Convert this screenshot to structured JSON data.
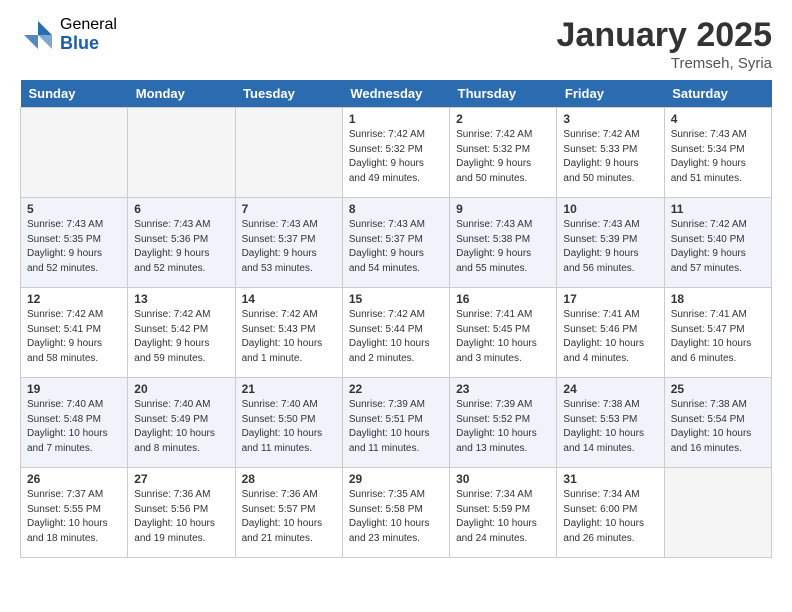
{
  "logo": {
    "general": "General",
    "blue": "Blue"
  },
  "header": {
    "month": "January 2025",
    "location": "Tremseh, Syria"
  },
  "weekdays": [
    "Sunday",
    "Monday",
    "Tuesday",
    "Wednesday",
    "Thursday",
    "Friday",
    "Saturday"
  ],
  "weeks": [
    [
      {
        "day": "",
        "info": ""
      },
      {
        "day": "",
        "info": ""
      },
      {
        "day": "",
        "info": ""
      },
      {
        "day": "1",
        "info": "Sunrise: 7:42 AM\nSunset: 5:32 PM\nDaylight: 9 hours\nand 49 minutes."
      },
      {
        "day": "2",
        "info": "Sunrise: 7:42 AM\nSunset: 5:32 PM\nDaylight: 9 hours\nand 50 minutes."
      },
      {
        "day": "3",
        "info": "Sunrise: 7:42 AM\nSunset: 5:33 PM\nDaylight: 9 hours\nand 50 minutes."
      },
      {
        "day": "4",
        "info": "Sunrise: 7:43 AM\nSunset: 5:34 PM\nDaylight: 9 hours\nand 51 minutes."
      }
    ],
    [
      {
        "day": "5",
        "info": "Sunrise: 7:43 AM\nSunset: 5:35 PM\nDaylight: 9 hours\nand 52 minutes."
      },
      {
        "day": "6",
        "info": "Sunrise: 7:43 AM\nSunset: 5:36 PM\nDaylight: 9 hours\nand 52 minutes."
      },
      {
        "day": "7",
        "info": "Sunrise: 7:43 AM\nSunset: 5:37 PM\nDaylight: 9 hours\nand 53 minutes."
      },
      {
        "day": "8",
        "info": "Sunrise: 7:43 AM\nSunset: 5:37 PM\nDaylight: 9 hours\nand 54 minutes."
      },
      {
        "day": "9",
        "info": "Sunrise: 7:43 AM\nSunset: 5:38 PM\nDaylight: 9 hours\nand 55 minutes."
      },
      {
        "day": "10",
        "info": "Sunrise: 7:43 AM\nSunset: 5:39 PM\nDaylight: 9 hours\nand 56 minutes."
      },
      {
        "day": "11",
        "info": "Sunrise: 7:42 AM\nSunset: 5:40 PM\nDaylight: 9 hours\nand 57 minutes."
      }
    ],
    [
      {
        "day": "12",
        "info": "Sunrise: 7:42 AM\nSunset: 5:41 PM\nDaylight: 9 hours\nand 58 minutes."
      },
      {
        "day": "13",
        "info": "Sunrise: 7:42 AM\nSunset: 5:42 PM\nDaylight: 9 hours\nand 59 minutes."
      },
      {
        "day": "14",
        "info": "Sunrise: 7:42 AM\nSunset: 5:43 PM\nDaylight: 10 hours\nand 1 minute."
      },
      {
        "day": "15",
        "info": "Sunrise: 7:42 AM\nSunset: 5:44 PM\nDaylight: 10 hours\nand 2 minutes."
      },
      {
        "day": "16",
        "info": "Sunrise: 7:41 AM\nSunset: 5:45 PM\nDaylight: 10 hours\nand 3 minutes."
      },
      {
        "day": "17",
        "info": "Sunrise: 7:41 AM\nSunset: 5:46 PM\nDaylight: 10 hours\nand 4 minutes."
      },
      {
        "day": "18",
        "info": "Sunrise: 7:41 AM\nSunset: 5:47 PM\nDaylight: 10 hours\nand 6 minutes."
      }
    ],
    [
      {
        "day": "19",
        "info": "Sunrise: 7:40 AM\nSunset: 5:48 PM\nDaylight: 10 hours\nand 7 minutes."
      },
      {
        "day": "20",
        "info": "Sunrise: 7:40 AM\nSunset: 5:49 PM\nDaylight: 10 hours\nand 8 minutes."
      },
      {
        "day": "21",
        "info": "Sunrise: 7:40 AM\nSunset: 5:50 PM\nDaylight: 10 hours\nand 11 minutes."
      },
      {
        "day": "22",
        "info": "Sunrise: 7:39 AM\nSunset: 5:51 PM\nDaylight: 10 hours\nand 11 minutes."
      },
      {
        "day": "23",
        "info": "Sunrise: 7:39 AM\nSunset: 5:52 PM\nDaylight: 10 hours\nand 13 minutes."
      },
      {
        "day": "24",
        "info": "Sunrise: 7:38 AM\nSunset: 5:53 PM\nDaylight: 10 hours\nand 14 minutes."
      },
      {
        "day": "25",
        "info": "Sunrise: 7:38 AM\nSunset: 5:54 PM\nDaylight: 10 hours\nand 16 minutes."
      }
    ],
    [
      {
        "day": "26",
        "info": "Sunrise: 7:37 AM\nSunset: 5:55 PM\nDaylight: 10 hours\nand 18 minutes."
      },
      {
        "day": "27",
        "info": "Sunrise: 7:36 AM\nSunset: 5:56 PM\nDaylight: 10 hours\nand 19 minutes."
      },
      {
        "day": "28",
        "info": "Sunrise: 7:36 AM\nSunset: 5:57 PM\nDaylight: 10 hours\nand 21 minutes."
      },
      {
        "day": "29",
        "info": "Sunrise: 7:35 AM\nSunset: 5:58 PM\nDaylight: 10 hours\nand 23 minutes."
      },
      {
        "day": "30",
        "info": "Sunrise: 7:34 AM\nSunset: 5:59 PM\nDaylight: 10 hours\nand 24 minutes."
      },
      {
        "day": "31",
        "info": "Sunrise: 7:34 AM\nSunset: 6:00 PM\nDaylight: 10 hours\nand 26 minutes."
      },
      {
        "day": "",
        "info": ""
      }
    ]
  ]
}
